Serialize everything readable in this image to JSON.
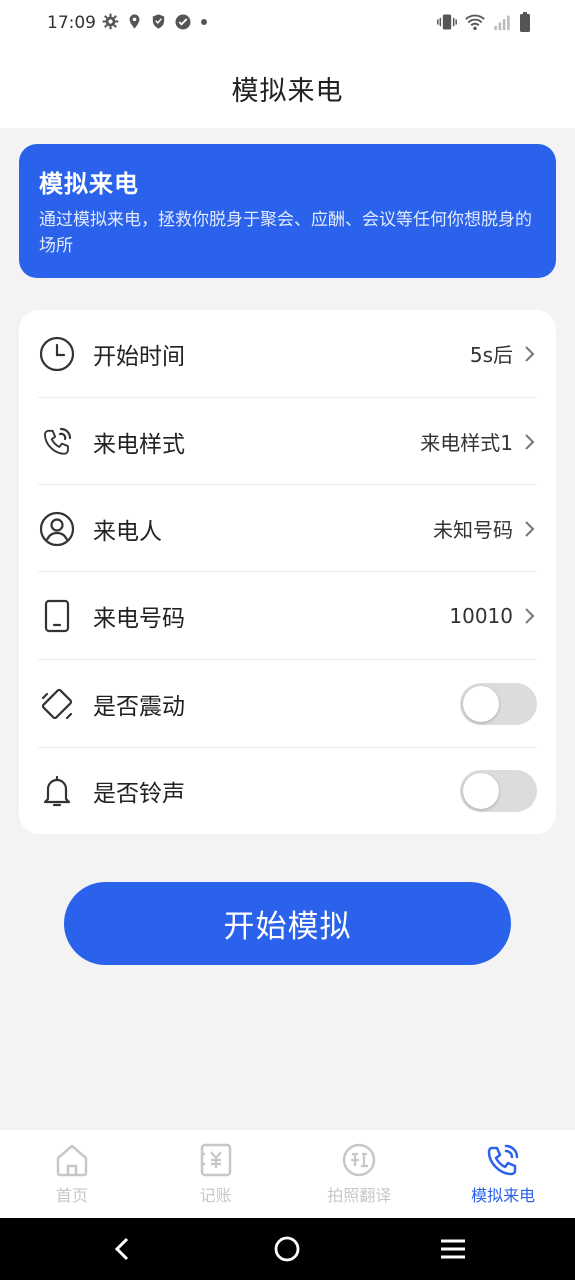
{
  "status": {
    "time": "17:09",
    "left_icons": [
      "gear-icon",
      "location-icon",
      "shield-icon",
      "check-badge-icon",
      "dot-icon"
    ],
    "right_icons": [
      "vibrate-icon",
      "wifi-icon",
      "signal-icon",
      "battery-icon"
    ]
  },
  "header": {
    "title": "模拟来电"
  },
  "banner": {
    "title": "模拟来电",
    "description": "通过模拟来电，拯救你脱身于聚会、应酬、会议等任何你想脱身的场所",
    "color": "#2a62ec"
  },
  "settings": {
    "start_time": {
      "label": "开始时间",
      "value": "5s后",
      "icon": "clock-icon"
    },
    "call_style": {
      "label": "来电样式",
      "value": "来电样式1",
      "icon": "phone-ringing-icon"
    },
    "caller": {
      "label": "来电人",
      "value": "未知号码",
      "icon": "user-circle-icon"
    },
    "caller_number": {
      "label": "来电号码",
      "value": "10010",
      "icon": "tablet-icon"
    },
    "vibrate": {
      "label": "是否震动",
      "enabled": false,
      "icon": "vibrate-phone-icon"
    },
    "ringtone": {
      "label": "是否铃声",
      "enabled": false,
      "icon": "bell-icon"
    }
  },
  "start_button": {
    "label": "开始模拟"
  },
  "tabs": [
    {
      "label": "首页",
      "icon": "home-icon",
      "active": false
    },
    {
      "label": "记账",
      "icon": "ledger-icon",
      "active": false
    },
    {
      "label": "拍照翻译",
      "icon": "translate-icon",
      "active": false
    },
    {
      "label": "模拟来电",
      "icon": "phone-ringing-icon",
      "active": true
    }
  ],
  "accent_color": "#2a62ec",
  "nav": [
    "back-icon",
    "home-circle-icon",
    "menu-icon"
  ]
}
